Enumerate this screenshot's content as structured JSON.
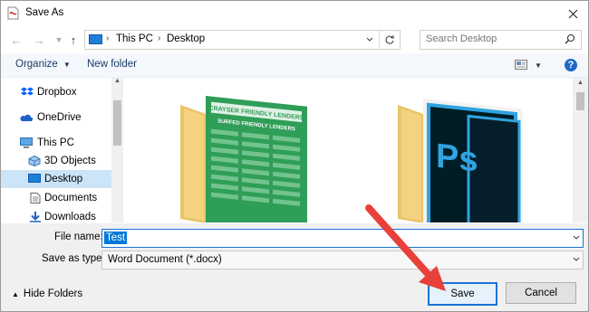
{
  "window": {
    "title": "Save As"
  },
  "address": {
    "crumbs": [
      "This PC",
      "Desktop"
    ]
  },
  "search": {
    "placeholder": "Search Desktop"
  },
  "toolbar": {
    "organize": "Organize",
    "new_folder": "New folder",
    "help": "?"
  },
  "sidebar": {
    "items": [
      {
        "label": "Dropbox",
        "icon": "dropbox-icon"
      },
      {
        "label": "OneDrive",
        "icon": "onedrive-icon"
      },
      {
        "label": "This PC",
        "icon": "this-pc-icon"
      },
      {
        "label": "3D Objects",
        "icon": "3d-objects-icon"
      },
      {
        "label": "Desktop",
        "icon": "desktop-icon",
        "selected": true
      },
      {
        "label": "Documents",
        "icon": "documents-icon"
      },
      {
        "label": "Downloads",
        "icon": "downloads-icon"
      }
    ]
  },
  "folders": [
    {
      "thumb_title_1": "CRAYSER FRIENDLY LENDERS",
      "thumb_title_2": "SURFED FRIENDLY LENDERS",
      "color": "#2f9e57"
    },
    {
      "thumb_text": "Ps",
      "color": "#2fa4e0"
    }
  ],
  "form": {
    "file_name_label": "File name:",
    "file_name_value": "Test",
    "save_type_label": "Save as type:",
    "save_type_value": "Word Document (*.docx)"
  },
  "buttons": {
    "hide_folders": "Hide Folders",
    "save": "Save",
    "cancel": "Cancel"
  },
  "colors": {
    "accent": "#0078d7",
    "selection": "#cce4f7",
    "annotation_arrow": "#e8403a"
  }
}
